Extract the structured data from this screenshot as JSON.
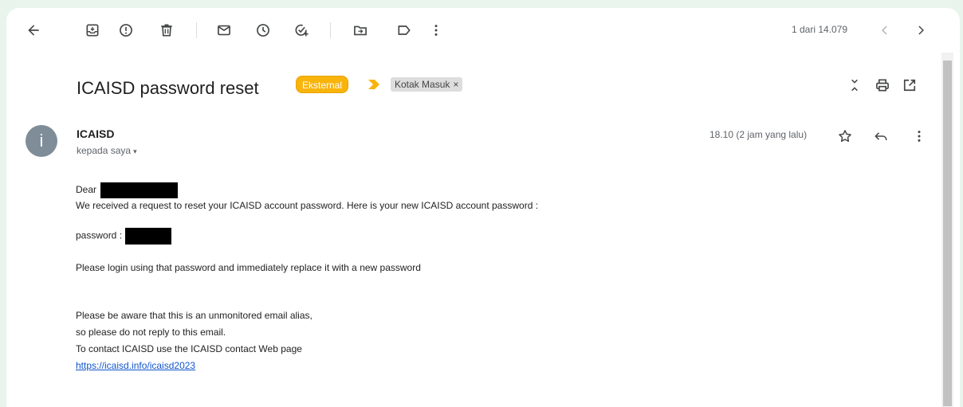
{
  "toolbar": {
    "icons": [
      "back-arrow-icon",
      "archive-icon",
      "report-spam-icon",
      "delete-icon",
      "mark-unread-icon",
      "snooze-icon",
      "add-task-icon",
      "move-to-icon",
      "label-icon",
      "more-vert-icon"
    ],
    "pager_text": "1 dari 14.079"
  },
  "subject": {
    "text": "ICAISD password reset",
    "external_label": "Eksternal",
    "inbox_label": "Kotak Masuk",
    "remove_label": "×"
  },
  "sender": {
    "avatar_letter": "i",
    "name": "ICAISD",
    "to": "kepada saya",
    "to_caret": "▾",
    "timestamp": "18.10 (2 jam yang lalu)"
  },
  "body": {
    "dear": "Dear",
    "line1": "We received a request to reset your ICAISD account password. Here is your new ICAISD account password :",
    "password_label": "password :",
    "line2": "Please login using that password and immediately replace it with a new password",
    "note1": "Please be aware that this is an unmonitored email alias,",
    "note2": "so please do not reply to this email.",
    "note3": "To contact ICAISD use the ICAISD contact Web page",
    "link": "https://icaisd.info/icaisd2023"
  },
  "colors": {
    "background": "#e9f5ec",
    "external_chip": "#f9b40b",
    "link": "#1155cc",
    "avatar": "#7e8d97"
  }
}
